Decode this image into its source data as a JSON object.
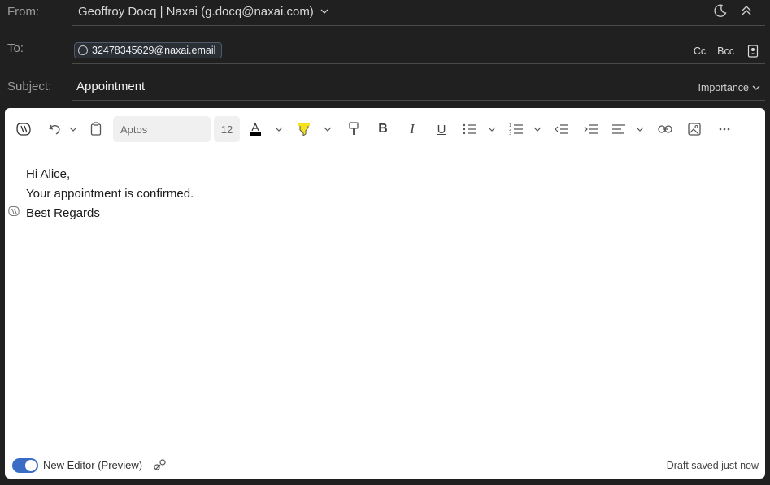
{
  "header": {
    "from_label": "From:",
    "from_value": "Geoffroy Docq | Naxai (g.docq@naxai.com)",
    "to_label": "To:",
    "to_recipient": "32478345629@naxai.email",
    "cc_label": "Cc",
    "bcc_label": "Bcc",
    "subject_label": "Subject:",
    "subject_value": "Appointment",
    "importance_label": "Importance"
  },
  "toolbar": {
    "font_name": "Aptos",
    "font_size": "12"
  },
  "body": {
    "lines": [
      "Hi Alice,",
      "Your appointment is confirmed.",
      "Best Regards"
    ]
  },
  "footer": {
    "new_editor_label": "New Editor (Preview)",
    "draft_status": "Draft saved just now"
  },
  "colors": {
    "background": "#202020",
    "accent": "#3b6cc5",
    "highlight": "#f5e21b"
  }
}
